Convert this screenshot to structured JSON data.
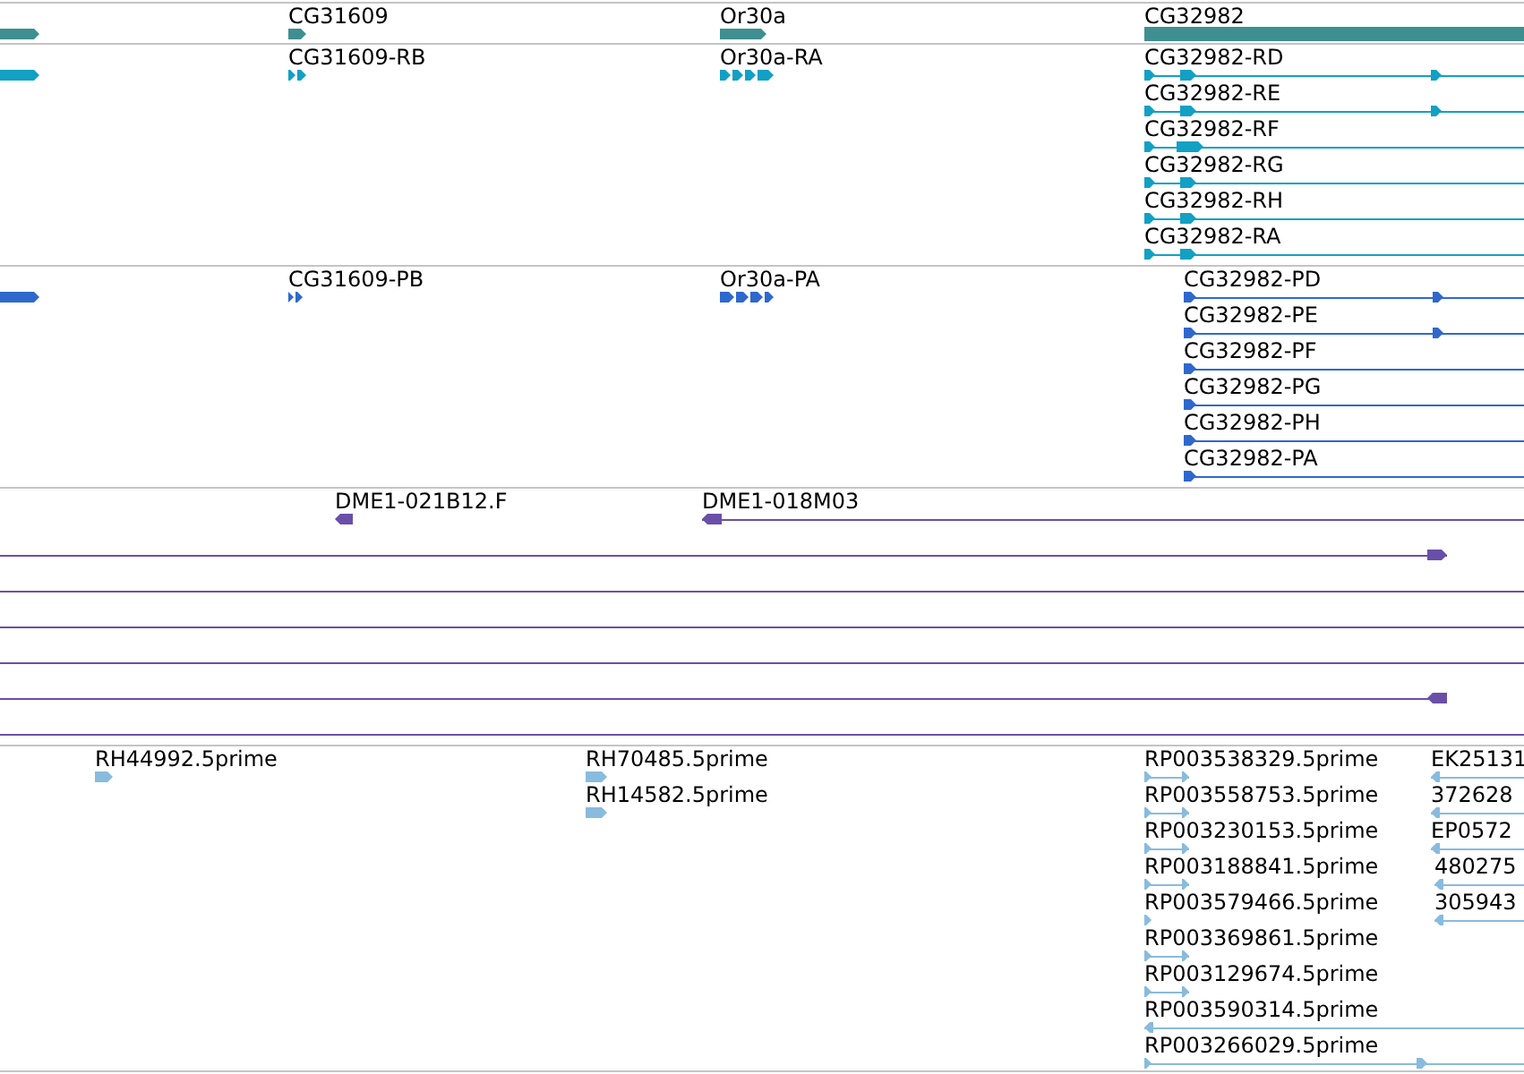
{
  "tracks": [
    {
      "kind": "gene",
      "features": [
        {
          "reverse": false
        },
        {
          "label": "CG31609",
          "reverse": false
        },
        {
          "label": "Or30a",
          "reverse": false
        },
        {
          "label": "CG32982"
        }
      ]
    },
    {
      "kind": "transcript",
      "features": [
        {
          "reverse": false
        },
        {
          "label": "CG31609-RB",
          "reverse": false
        },
        {
          "label": "Or30a-RA",
          "reverse": false
        },
        {
          "label": "CG32982-RD",
          "reverse": false
        },
        {
          "label": "CG32982-RE",
          "reverse": false
        },
        {
          "label": "CG32982-RF",
          "reverse": false
        },
        {
          "label": "CG32982-RG",
          "reverse": false
        },
        {
          "label": "CG32982-RH",
          "reverse": false
        },
        {
          "label": "CG32982-RA",
          "reverse": false
        }
      ]
    },
    {
      "kind": "protein",
      "features": [
        {
          "reverse": false
        },
        {
          "label": "CG31609-PB",
          "reverse": false
        },
        {
          "label": "Or30a-PA",
          "reverse": false
        },
        {
          "label": "CG32982-PD",
          "reverse": false
        },
        {
          "label": "CG32982-PE",
          "reverse": false
        },
        {
          "label": "CG32982-PF",
          "reverse": false
        },
        {
          "label": "CG32982-PG",
          "reverse": false
        },
        {
          "label": "CG32982-PH",
          "reverse": false
        },
        {
          "label": "CG32982-PA",
          "reverse": false
        }
      ]
    },
    {
      "kind": "clone",
      "features": [
        {
          "label": "DME1-021B12.F",
          "reverse": true
        },
        {
          "label": "DME1-018M03",
          "reverse": true
        },
        {
          "reverse": false
        },
        {
          "reverse": true
        }
      ]
    },
    {
      "kind": "est",
      "features": [
        {
          "label": "RH44992.5prime",
          "reverse": false
        },
        {
          "label": "RH70485.5prime",
          "reverse": false
        },
        {
          "label": "RH14582.5prime",
          "reverse": false
        },
        {
          "label": "RP003538329.5prime",
          "reverse": false
        },
        {
          "label": "RP003558753.5prime",
          "reverse": false
        },
        {
          "label": "RP003230153.5prime",
          "reverse": false
        },
        {
          "label": "RP003188841.5prime",
          "reverse": false
        },
        {
          "label": "RP003579466.5prime",
          "reverse": false
        },
        {
          "label": "RP003369861.5prime",
          "reverse": false
        },
        {
          "label": "RP003129674.5prime",
          "reverse": false
        },
        {
          "label": "RP003590314.5prime",
          "reverse": true
        },
        {
          "label": "RP003266029.5prime",
          "reverse": false
        },
        {
          "label": "EK25131",
          "reverse": true
        },
        {
          "label": "372628",
          "reverse": true
        },
        {
          "label": "EP0572",
          "reverse": true
        },
        {
          "label": "480275",
          "reverse": true
        },
        {
          "label": "305943",
          "reverse": true
        }
      ]
    }
  ]
}
